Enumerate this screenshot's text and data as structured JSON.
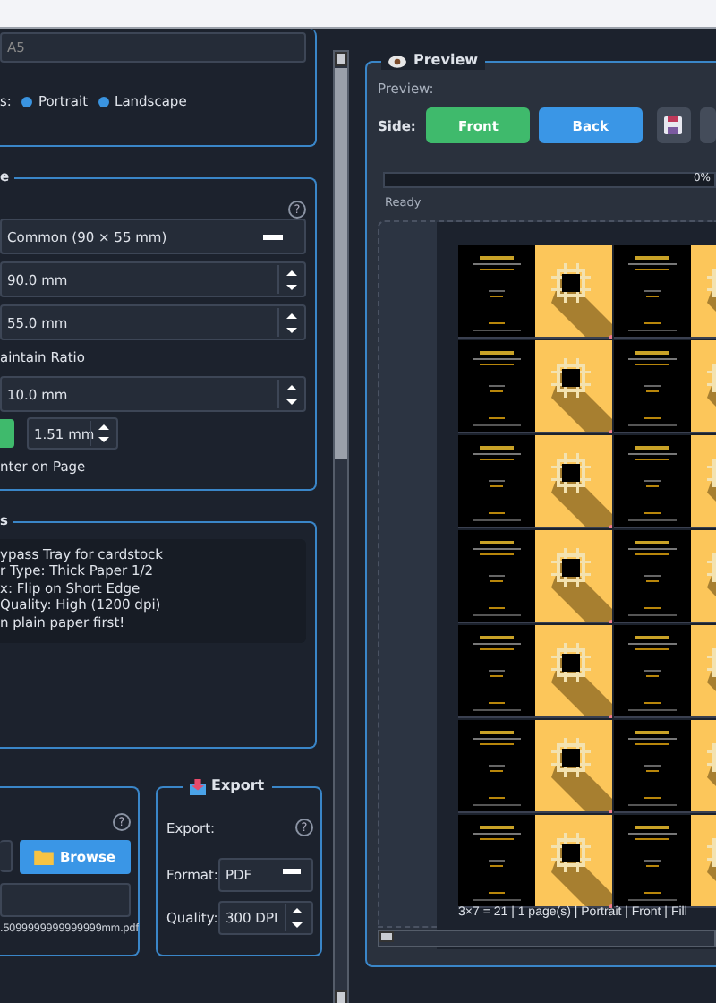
{
  "page_setup": {
    "paper": "A5",
    "orientation_label": "s:",
    "orientations": [
      {
        "label": "Portrait",
        "checked": true
      },
      {
        "label": "Landscape",
        "checked": true
      }
    ]
  },
  "size": {
    "title": "e",
    "help": "?",
    "preset": "Common (90 × 55 mm)",
    "width": "90.0 mm",
    "height": "55.0 mm",
    "maintain_ratio": "aintain Ratio",
    "spacing": "10.0 mm",
    "bleed": "1.51 mm",
    "center": "nter on Page"
  },
  "notes": {
    "title": "s",
    "lines": [
      "ypass Tray for cardstock",
      "r Type: Thick Paper 1/2",
      "x: Flip on Short Edge",
      "Quality: High (1200 dpi)",
      "n plain paper first!"
    ]
  },
  "output": {
    "help": "?",
    "browse": "Browse",
    "filename": ".5099999999999999mm.pdf"
  },
  "export": {
    "title": "Export",
    "label": "Export:",
    "help": "?",
    "format_label": "Format:",
    "format": "PDF",
    "quality_label": "Quality:",
    "quality": "300 DPI"
  },
  "preview": {
    "title": "Preview",
    "label": "Preview:",
    "side_label": "Side:",
    "sides": [
      {
        "label": "Front",
        "selected": true
      },
      {
        "label": "Back",
        "selected": false
      }
    ],
    "progress": {
      "level": 0,
      "reading": "0%"
    },
    "status": "Ready",
    "summary": "3×7 = 21 | 1 page(s) | Portrait | Front | Fill"
  }
}
